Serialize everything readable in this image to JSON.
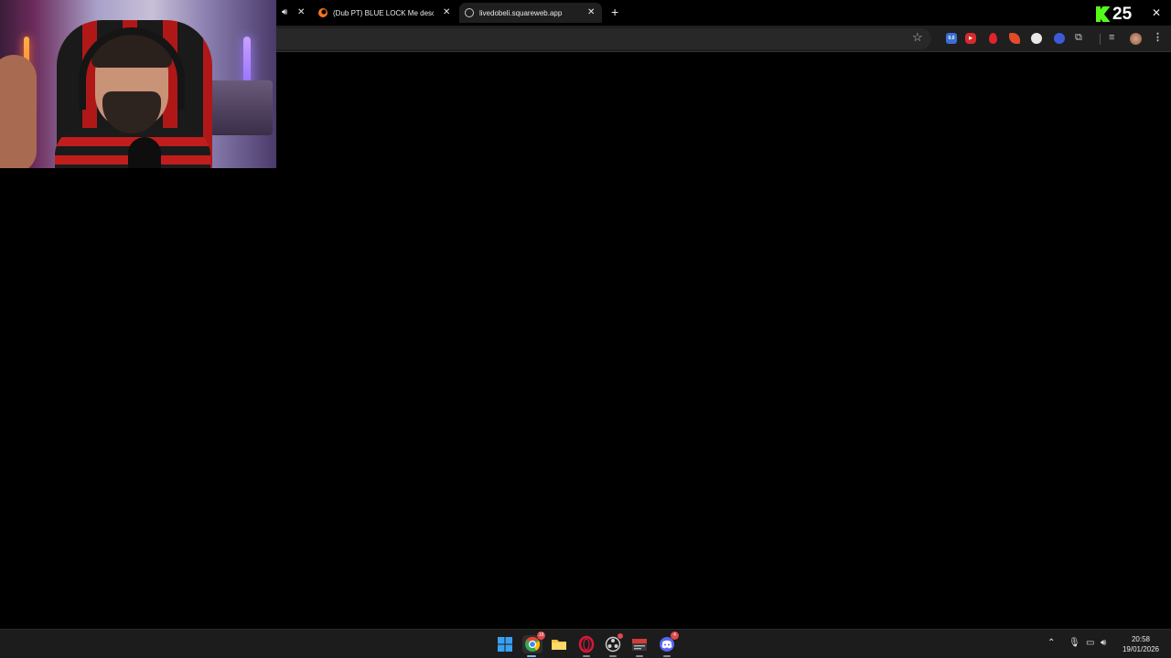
{
  "browser": {
    "tabs": [
      {
        "title": "(Dub PT) BLUE LOCK Me descu",
        "favicon": "crunchyroll-icon",
        "active": false
      },
      {
        "title": "livedobeli.squareweb.app",
        "favicon": "globe-icon",
        "active": true
      }
    ],
    "new_tab_symbol": "+",
    "kick_badge": {
      "logo": "K",
      "count": "25",
      "color": "#53fc18"
    },
    "close_symbol": "✕"
  },
  "toolbar": {
    "extensions": [
      {
        "name": "ext-counter-icon",
        "label": "0.0",
        "color": "#3b6fd4"
      },
      {
        "name": "ext-youtube-icon",
        "label": "▶",
        "color": "#d62b2b"
      },
      {
        "name": "ext-red-drop-icon",
        "label": "",
        "color": "#e0242a"
      },
      {
        "name": "ext-red-leaf-icon",
        "label": "",
        "color": "#e24b2a"
      },
      {
        "name": "ext-white-cloud-icon",
        "label": "",
        "color": "#e8e8e8"
      },
      {
        "name": "ext-blue-circle-icon",
        "label": "",
        "color": "#3b5bd9"
      }
    ]
  },
  "taskbar": {
    "apps": [
      {
        "name": "windows-start-icon",
        "color": "#3aa0f2",
        "badge": ""
      },
      {
        "name": "chrome-icon",
        "color": "#34a853",
        "badge": "19"
      },
      {
        "name": "file-explorer-icon",
        "color": "#f5c33b",
        "badge": ""
      },
      {
        "name": "opera-icon",
        "color": "#d2183a",
        "badge": ""
      },
      {
        "name": "obs-icon",
        "color": "#d0d0d0",
        "badge": ""
      },
      {
        "name": "streaming-app-icon",
        "color": "#d63a3a",
        "badge": ""
      },
      {
        "name": "discord-icon",
        "color": "#5865f2",
        "badge": "4"
      }
    ],
    "clock_time": "20:58",
    "clock_date": "19/01/2026"
  }
}
